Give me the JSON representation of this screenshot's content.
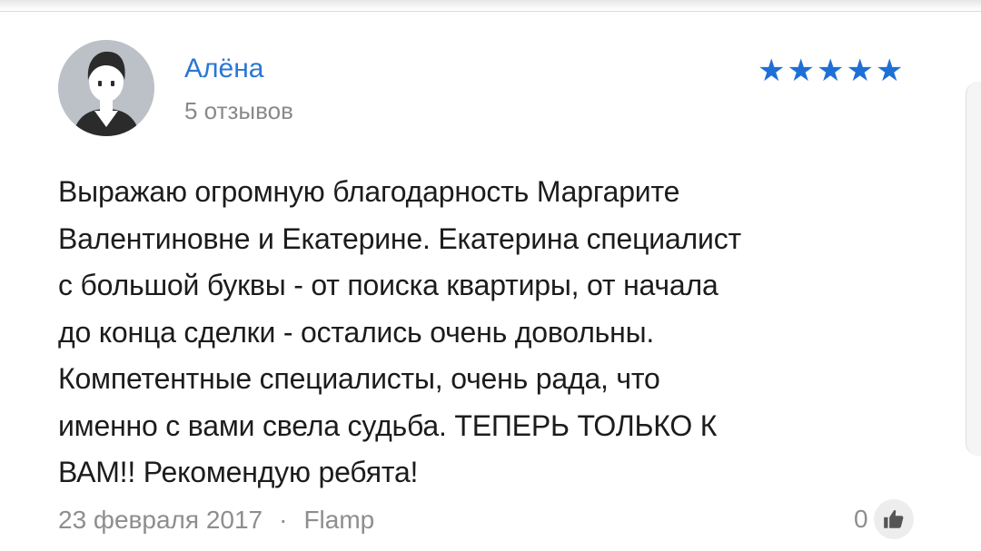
{
  "review": {
    "author": {
      "name": "Алёна",
      "reviews_count": "5 отзывов",
      "avatar_icon": "user-silhouette-icon"
    },
    "rating": {
      "value": 5,
      "max": 5,
      "stars": [
        "★",
        "★",
        "★",
        "★",
        "★"
      ],
      "color": "#1e6fd6"
    },
    "text": "Выражаю огромную благодарность Маргарите\nВалентиновне  и Екатерине. Екатерина  специалист\nс большой буквы  - от поиска  квартиры,   от начала\nдо конца сделки - остались очень довольны.\nКомпетентные специалисты, очень  рада, что\nименно  с вами свела судьба. ТЕПЕРЬ ТОЛЬКО К\nВАМ!! Рекомендую  ребята!",
    "date": "23 февраля 2017",
    "separator": "·",
    "source": "Flamp",
    "likes": "0",
    "like_icon": "thumbs-up-icon"
  },
  "colors": {
    "author_link": "#2a77d4",
    "muted_text": "#8e8e8e"
  }
}
